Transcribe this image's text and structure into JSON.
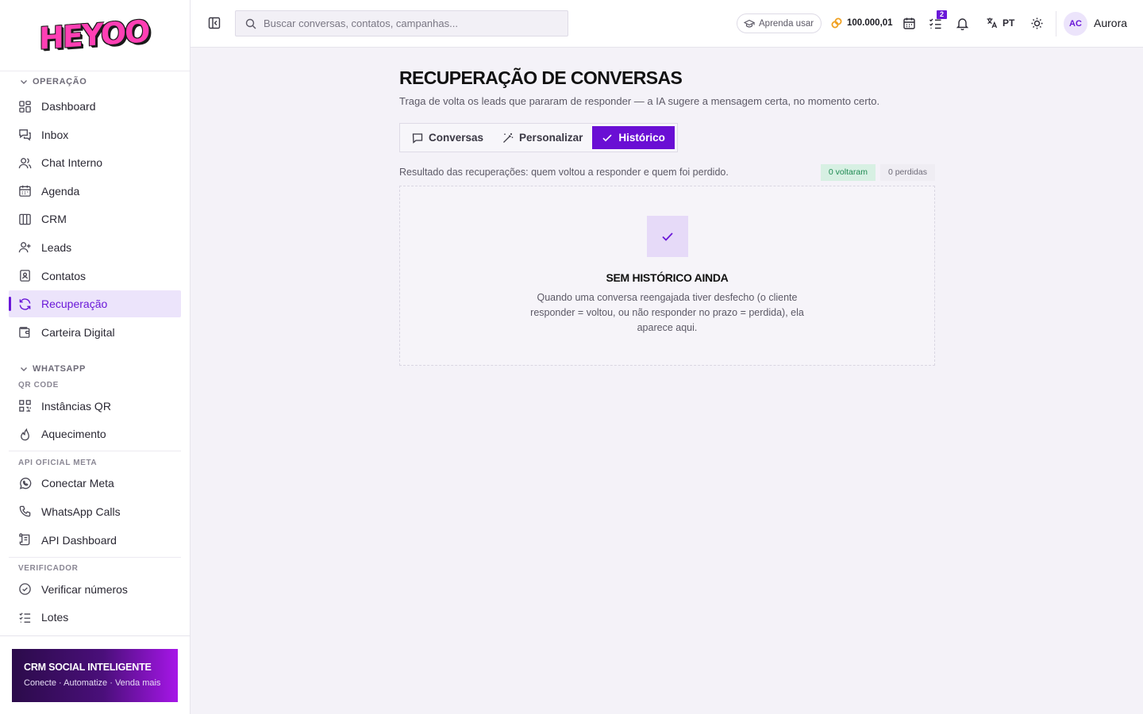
{
  "brand": {
    "logo_text": "HEYOO"
  },
  "sidebar": {
    "sections": {
      "operacao": "OPERAÇÃO",
      "whatsapp": "WHATSAPP",
      "qr_code": "QR CODE",
      "api_oficial": "API OFICIAL META",
      "verificador": "VERIFICADOR"
    },
    "items": {
      "dashboard": "Dashboard",
      "inbox": "Inbox",
      "chat_interno": "Chat Interno",
      "agenda": "Agenda",
      "crm": "CRM",
      "leads": "Leads",
      "contatos": "Contatos",
      "recuperacao": "Recuperação",
      "carteira": "Carteira Digital",
      "instancias_qr": "Instâncias QR",
      "aquecimento": "Aquecimento",
      "conectar_meta": "Conectar Meta",
      "whatsapp_calls": "WhatsApp Calls",
      "api_dashboard": "API Dashboard",
      "verificar_numeros": "Verificar números",
      "lotes": "Lotes"
    },
    "active_item": "recuperacao",
    "promo": {
      "title": "CRM SOCIAL INTELIGENTE",
      "subtitle": "Conecte · Automatize · Venda mais"
    }
  },
  "topbar": {
    "search_placeholder": "Buscar conversas, contatos, campanhas...",
    "learn_label": "Aprenda usar",
    "coins": "100.000,01",
    "tasks_badge": "2",
    "language": "PT",
    "avatar_initials": "AC",
    "username": "Aurora"
  },
  "main": {
    "title": "RECUPERAÇÃO DE CONVERSAS",
    "subtitle": "Traga de volta os leads que pararam de responder — a IA sugere a mensagem certa, no momento certo.",
    "tabs": [
      {
        "label": "Conversas",
        "icon": "chat-bubble-icon",
        "active": false
      },
      {
        "label": "Personalizar",
        "icon": "magic-wand-icon",
        "active": false
      },
      {
        "label": "Histórico",
        "icon": "check-icon",
        "active": true
      }
    ],
    "result_text": "Resultado das recuperações: quem voltou a responder e quem foi perdido.",
    "chip_voltaram": "0 voltaram",
    "chip_perdidas": "0 perdidas",
    "empty": {
      "title": "SEM HISTÓRICO AINDA",
      "description": "Quando uma conversa reengajada tiver desfecho (o cliente responder = voltou, ou não responder no prazo = perdida), ela aparece aqui."
    }
  },
  "colors": {
    "accent": "#6a0fd4",
    "active_bg": "#ece4fb",
    "success_bg": "#d7f0e3",
    "success_text": "#1e8a52"
  }
}
